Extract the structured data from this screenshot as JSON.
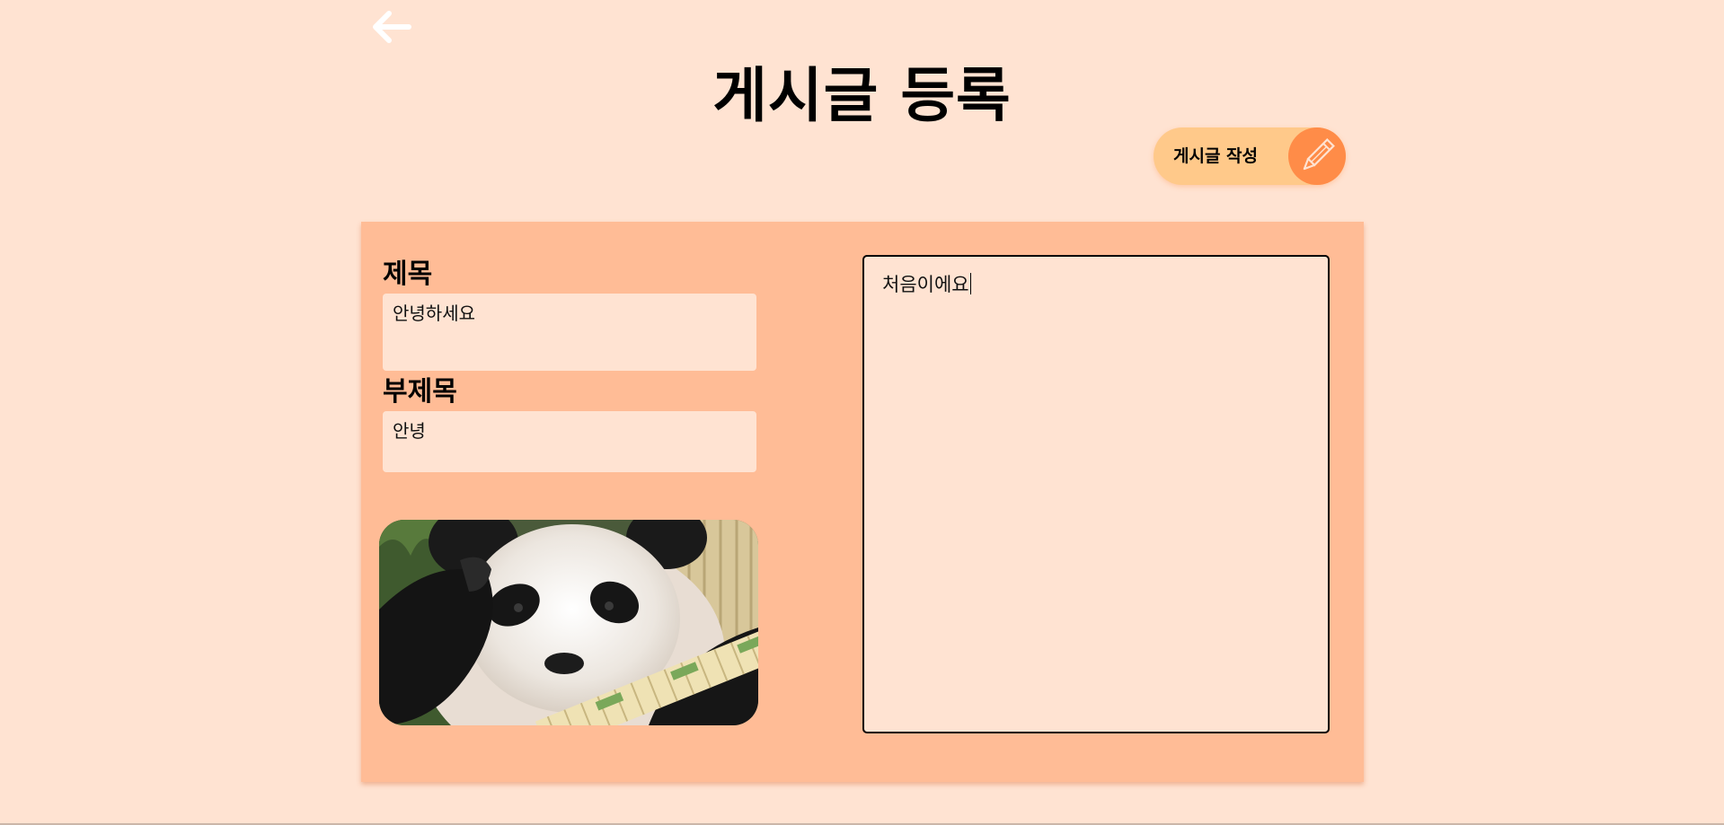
{
  "header": {
    "back_icon": "arrow-left-icon",
    "title": "게시글 등록",
    "write_button_label": "게시글 작성",
    "write_button_icon": "pencil-icon"
  },
  "form": {
    "title_label": "제목",
    "title_value": "안녕하세요",
    "subtitle_label": "부제목",
    "subtitle_value": "안녕",
    "image_subject": "panda-photo",
    "content_value": "처음이에요"
  },
  "colors": {
    "background": "#ffe3d2",
    "card": "#ffbc96",
    "button": "#ffc98a",
    "button_accent": "#ff8c48"
  }
}
